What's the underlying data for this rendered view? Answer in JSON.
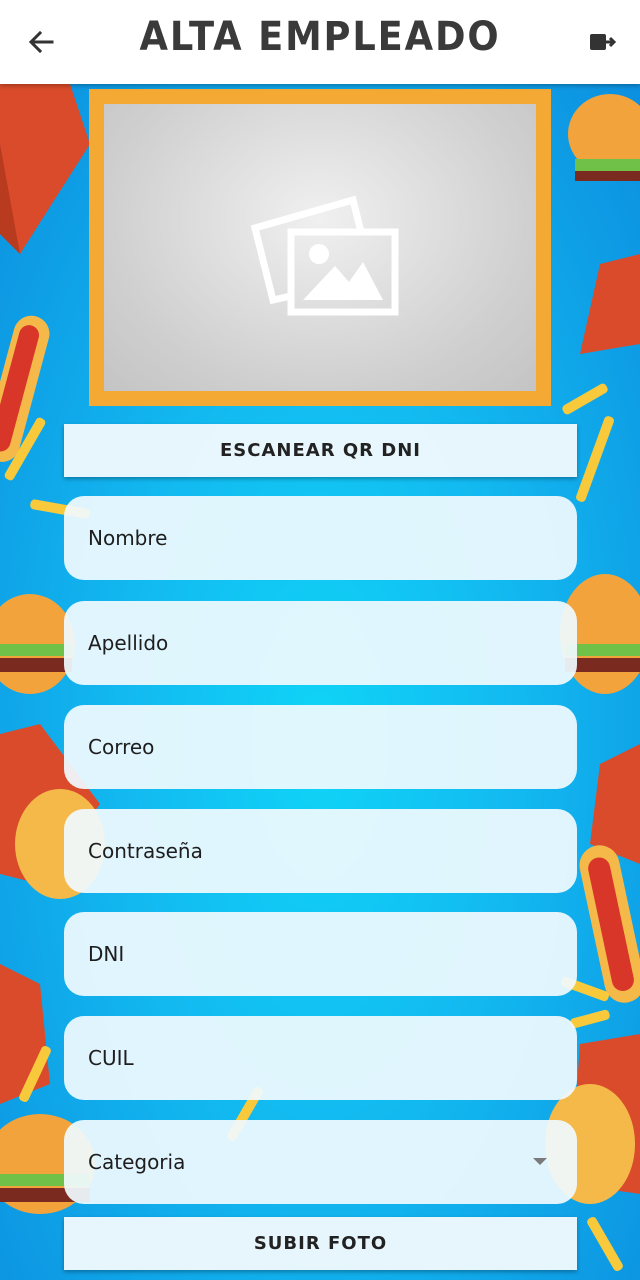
{
  "header": {
    "title": "ALTA EMPLEADO",
    "back_icon": "arrow-left-icon",
    "logout_icon": "logout-icon"
  },
  "photo": {
    "icon": "image-placeholder-icon"
  },
  "buttons": {
    "scan_label": "ESCANEAR QR DNI",
    "upload_label": "SUBIR FOTO"
  },
  "form": {
    "nombre": "Nombre",
    "apellido": "Apellido",
    "correo": "Correo",
    "contrasena": "Contraseña",
    "dni": "DNI",
    "cuil": "CUIL",
    "categoria": "Categoria"
  },
  "colors": {
    "accent_frame": "#f4a935",
    "background": "#12b8f0",
    "field_bg": "#f0fafe",
    "title": "#3a3a3a"
  }
}
